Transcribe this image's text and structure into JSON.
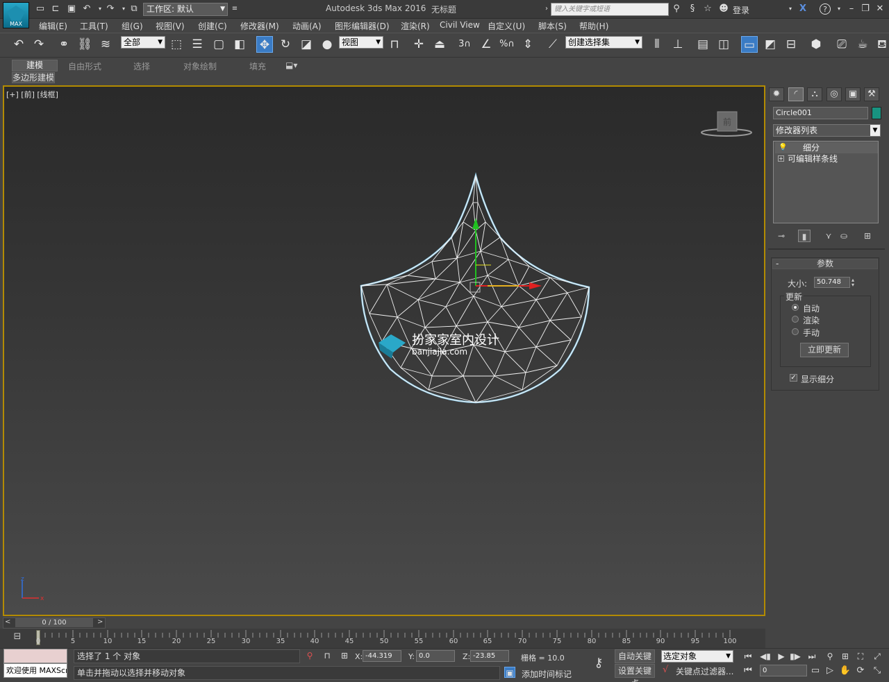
{
  "app": {
    "title": "Autodesk 3ds Max 2016",
    "document": "无标题",
    "logo_text": "MAX",
    "workspace": "工作区: 默认",
    "search_placeholder": "键入关键字或短语",
    "login": "登录"
  },
  "menu": [
    "编辑(E)",
    "工具(T)",
    "组(G)",
    "视图(V)",
    "创建(C)",
    "修改器(M)",
    "动画(A)",
    "图形编辑器(D)",
    "渲染(R)",
    "Civil View",
    "自定义(U)",
    "脚本(S)",
    "帮助(H)"
  ],
  "toolbar": {
    "filter": "全部",
    "ref_coord": "视图",
    "named_selection": "创建选择集",
    "snap_labels": [
      "3",
      "%"
    ]
  },
  "ribbon": {
    "tabs": [
      "建模",
      "自由形式",
      "选择",
      "对象绘制",
      "填充"
    ],
    "subtab": "多边形建模"
  },
  "viewport": {
    "label": "[+] [前] [线框]",
    "viewcube": "前",
    "watermark_title": "扮家家室内设计",
    "watermark_url": "banjiajia.com",
    "axis_z": "z",
    "axis_x": "x"
  },
  "command_panel": {
    "object_name": "Circle001",
    "object_color": "#189380",
    "modifier_list": "修改器列表",
    "stack": [
      "细分",
      "可编辑样条线"
    ],
    "rollout_title": "参数",
    "size_label": "大小:",
    "size_value": "50.748",
    "update_group": "更新",
    "update_options": [
      "自动",
      "渲染",
      "手动"
    ],
    "update_selected": 0,
    "update_button": "立即更新",
    "show_subdivision": "显示细分",
    "show_checked": true
  },
  "timeline": {
    "frame_display": "0 / 100",
    "ticks": [
      "0",
      "5",
      "10",
      "15",
      "20",
      "25",
      "30",
      "35",
      "40",
      "45",
      "50",
      "55",
      "60",
      "65",
      "70",
      "75",
      "80",
      "85",
      "90",
      "95",
      "100"
    ]
  },
  "status": {
    "welcome": "欢迎使用 MAXScri",
    "selection": "选择了 1 个 对象",
    "prompt": "单击并拖动以选择并移动对象",
    "x_label": "X:",
    "x_value": "-44.319",
    "y_label": "Y:",
    "y_value": "0.0",
    "z_label": "Z:",
    "z_value": "-23.85",
    "grid": "栅格 = 10.0",
    "add_time_tag": "添加时间标记",
    "auto_key": "自动关键点",
    "set_key": "设置关键点",
    "selected_object": "选定对象",
    "key_filters": "关键点过滤器...",
    "frame": "0"
  }
}
